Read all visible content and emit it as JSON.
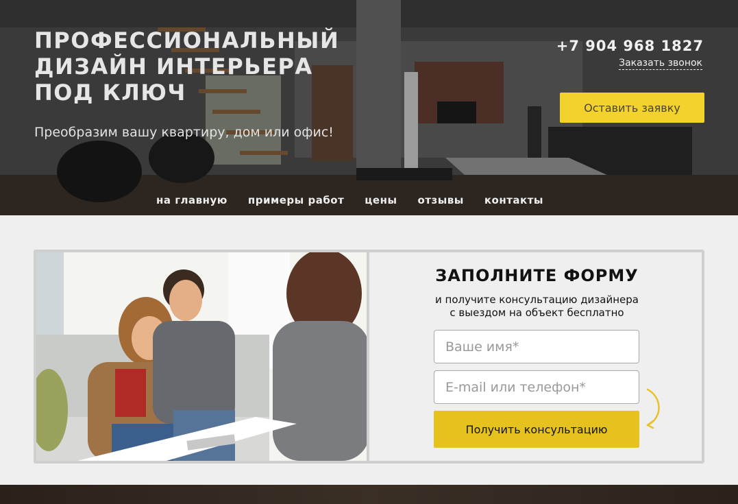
{
  "header": {
    "title": "ПРОФЕССИОНАЛЬНЫЙ\nДИЗАЙН ИНТЕРЬЕРА\nПОД КЛЮЧ",
    "subtitle": "Преобразим вашу квартиру, дом или офис!",
    "phone": "+7 904 968 1827",
    "callback_label": "Заказать звонок",
    "cta_label": "Оставить заявку"
  },
  "nav": {
    "items": [
      "на главную",
      "примеры работ",
      "цены",
      "отзывы",
      "контакты"
    ]
  },
  "form": {
    "title": "ЗАПОЛНИТЕ ФОРМУ",
    "description": "и получите консультацию дизайнера\nс выездом на объект бесплатно",
    "name_placeholder": "Ваше имя*",
    "contact_placeholder": "E-mail или телефон*",
    "submit_label": "Получить консультацию"
  },
  "colors": {
    "accent": "#f3d22e",
    "submit": "#e6c21e",
    "card_border": "#cfcfcf"
  }
}
